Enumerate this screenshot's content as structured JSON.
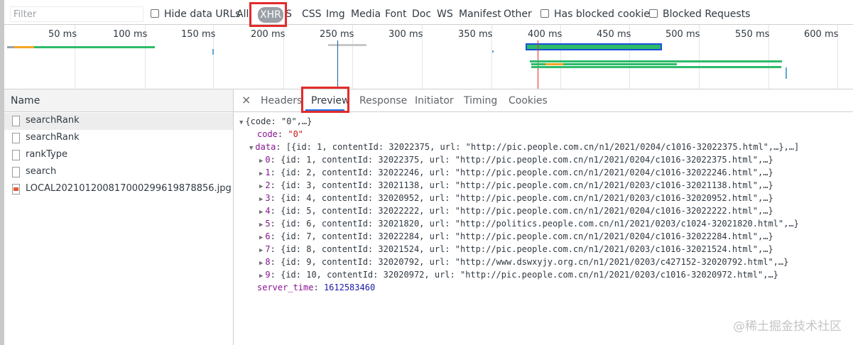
{
  "filter": {
    "placeholder": "Filter",
    "hide_data_urls": "Hide data URLs",
    "types": [
      "All",
      "XHR",
      "JS",
      "CSS",
      "Img",
      "Media",
      "Font",
      "Doc",
      "WS",
      "Manifest",
      "Other"
    ],
    "selected_type": "XHR",
    "has_blocked_cookies": "Has blocked cookies",
    "blocked_requests": "Blocked Requests"
  },
  "overview": {
    "ticks": [
      "50 ms",
      "100 ms",
      "150 ms",
      "200 ms",
      "250 ms",
      "300 ms",
      "350 ms",
      "400 ms",
      "450 ms",
      "500 ms",
      "550 ms",
      "600 ms"
    ]
  },
  "requests": {
    "header": "Name",
    "items": [
      {
        "name": "searchRank",
        "icon": "file-icon"
      },
      {
        "name": "searchRank",
        "icon": "file-icon"
      },
      {
        "name": "rankType",
        "icon": "file-icon"
      },
      {
        "name": "search",
        "icon": "file-icon"
      },
      {
        "name": "LOCAL20210120081700029961987885‌6.jpg",
        "icon": "image-icon"
      }
    ]
  },
  "detail": {
    "tabs": [
      "Headers",
      "Preview",
      "Response",
      "Initiator",
      "Timing",
      "Cookies"
    ],
    "active_tab": "Preview",
    "preview": {
      "root": "{code: \"0\",…}",
      "code_key": "code",
      "code_value": "\"0\"",
      "data_key": "data",
      "data_summary": "[{id: 1, contentId: 32022375, url: \"http://pic.people.com.cn/n1/2021/0204/c1016-32022375.html\",…},…]",
      "items": [
        {
          "idx": "0",
          "text": "{id: 1, contentId: 32022375, url: \"http://pic.people.com.cn/n1/2021/0204/c1016-32022375.html\",…}"
        },
        {
          "idx": "1",
          "text": "{id: 2, contentId: 32022246, url: \"http://pic.people.com.cn/n1/2021/0204/c1016-32022246.html\",…}"
        },
        {
          "idx": "2",
          "text": "{id: 3, contentId: 32021138, url: \"http://pic.people.com.cn/n1/2021/0203/c1016-32021138.html\",…}"
        },
        {
          "idx": "3",
          "text": "{id: 4, contentId: 32020952, url: \"http://pic.people.com.cn/n1/2021/0203/c1016-32020952.html\",…}"
        },
        {
          "idx": "4",
          "text": "{id: 5, contentId: 32022222, url: \"http://pic.people.com.cn/n1/2021/0204/c1016-32022222.html\",…}"
        },
        {
          "idx": "5",
          "text": "{id: 6, contentId: 32021820, url: \"http://politics.people.com.cn/n1/2021/0203/c1024-32021820.html\",…}"
        },
        {
          "idx": "6",
          "text": "{id: 7, contentId: 32022284, url: \"http://pic.people.com.cn/n1/2021/0204/c1016-32022284.html\",…}"
        },
        {
          "idx": "7",
          "text": "{id: 8, contentId: 32021524, url: \"http://pic.people.com.cn/n1/2021/0203/c1016-32021524.html\",…}"
        },
        {
          "idx": "8",
          "text": "{id: 9, contentId: 32020792, url: \"http://www.dswxyjy.org.cn/n1/2021/0203/c427152-32020792.html\",…}"
        },
        {
          "idx": "9",
          "text": "{id: 10, contentId: 32020972, url: \"http://pic.people.com.cn/n1/2021/0203/c1016-32020972.html\",…}"
        }
      ],
      "server_time_key": "server_time",
      "server_time_value": "1612583460"
    }
  },
  "watermark": "@稀土掘金技术社区",
  "colors": {
    "highlight": "#e32b2b",
    "selected_tab_underline": "#1a73e8"
  }
}
